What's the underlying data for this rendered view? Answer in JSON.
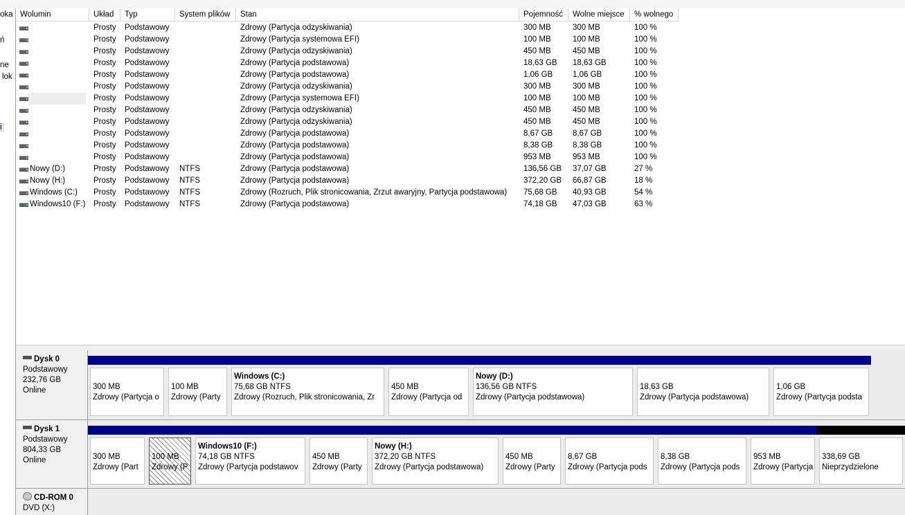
{
  "left_nav": [
    "oka",
    "ń",
    "ne",
    "lok",
    "i"
  ],
  "columns": [
    "Wolumin",
    "Układ",
    "Typ",
    "System plików",
    "Stan",
    "Pojemność",
    "Wolne miejsce",
    "% wolnego"
  ],
  "volumes": [
    {
      "name": "",
      "layout": "Prosty",
      "type": "Podstawowy",
      "fs": "",
      "status": "Zdrowy (Partycja odzyskiwania)",
      "capacity": "300 MB",
      "free": "300 MB",
      "pct": "100 %"
    },
    {
      "name": "",
      "layout": "Prosty",
      "type": "Podstawowy",
      "fs": "",
      "status": "Zdrowy (Partycja systemowa EFI)",
      "capacity": "100 MB",
      "free": "100 MB",
      "pct": "100 %"
    },
    {
      "name": "",
      "layout": "Prosty",
      "type": "Podstawowy",
      "fs": "",
      "status": "Zdrowy (Partycja odzyskiwania)",
      "capacity": "450 MB",
      "free": "450 MB",
      "pct": "100 %"
    },
    {
      "name": "",
      "layout": "Prosty",
      "type": "Podstawowy",
      "fs": "",
      "status": "Zdrowy (Partycja podstawowa)",
      "capacity": "18,63 GB",
      "free": "18,63 GB",
      "pct": "100 %"
    },
    {
      "name": "",
      "layout": "Prosty",
      "type": "Podstawowy",
      "fs": "",
      "status": "Zdrowy (Partycja podstawowa)",
      "capacity": "1,06 GB",
      "free": "1,06 GB",
      "pct": "100 %"
    },
    {
      "name": "",
      "layout": "Prosty",
      "type": "Podstawowy",
      "fs": "",
      "status": "Zdrowy (Partycja odzyskiwania)",
      "capacity": "300 MB",
      "free": "300 MB",
      "pct": "100 %"
    },
    {
      "name": "",
      "layout": "Prosty",
      "type": "Podstawowy",
      "fs": "",
      "status": "Zdrowy (Partycja systemowa EFI)",
      "capacity": "100 MB",
      "free": "100 MB",
      "pct": "100 %"
    },
    {
      "name": "",
      "layout": "Prosty",
      "type": "Podstawowy",
      "fs": "",
      "status": "Zdrowy (Partycja odzyskiwania)",
      "capacity": "450 MB",
      "free": "450 MB",
      "pct": "100 %"
    },
    {
      "name": "",
      "layout": "Prosty",
      "type": "Podstawowy",
      "fs": "",
      "status": "Zdrowy (Partycja odzyskiwania)",
      "capacity": "450 MB",
      "free": "450 MB",
      "pct": "100 %"
    },
    {
      "name": "",
      "layout": "Prosty",
      "type": "Podstawowy",
      "fs": "",
      "status": "Zdrowy (Partycja podstawowa)",
      "capacity": "8,67 GB",
      "free": "8,67 GB",
      "pct": "100 %"
    },
    {
      "name": "",
      "layout": "Prosty",
      "type": "Podstawowy",
      "fs": "",
      "status": "Zdrowy (Partycja podstawowa)",
      "capacity": "8,38 GB",
      "free": "8,38 GB",
      "pct": "100 %"
    },
    {
      "name": "",
      "layout": "Prosty",
      "type": "Podstawowy",
      "fs": "",
      "status": "Zdrowy (Partycja podstawowa)",
      "capacity": "953 MB",
      "free": "953 MB",
      "pct": "100 %"
    },
    {
      "name": "Nowy (D:)",
      "layout": "Prosty",
      "type": "Podstawowy",
      "fs": "NTFS",
      "status": "Zdrowy (Partycja podstawowa)",
      "capacity": "136,56 GB",
      "free": "37,07 GB",
      "pct": "27 %"
    },
    {
      "name": "Nowy (H:)",
      "layout": "Prosty",
      "type": "Podstawowy",
      "fs": "NTFS",
      "status": "Zdrowy (Partycja podstawowa)",
      "capacity": "372,20 GB",
      "free": "66,87 GB",
      "pct": "18 %"
    },
    {
      "name": "Windows (C:)",
      "layout": "Prosty",
      "type": "Podstawowy",
      "fs": "NTFS",
      "status": "Zdrowy (Rozruch, Plik stronicowania, Zrzut awaryjny, Partycja podstawowa)",
      "capacity": "75,68 GB",
      "free": "40,93 GB",
      "pct": "54 %"
    },
    {
      "name": "Windows10 (F:)",
      "layout": "Prosty",
      "type": "Podstawowy",
      "fs": "NTFS",
      "status": "Zdrowy (Partycja podstawowa)",
      "capacity": "74,18 GB",
      "free": "47,03 GB",
      "pct": "63 %"
    }
  ],
  "disks": [
    {
      "name": "Dysk 0",
      "kind": "Podstawowy",
      "size": "232,76 GB",
      "state": "Online",
      "partitions": [
        {
          "title": "",
          "line1": "300 MB",
          "line2": "Zdrowy (Partycja o"
        },
        {
          "title": "",
          "line1": "100 MB",
          "line2": "Zdrowy (Party"
        },
        {
          "title": "Windows  (C:)",
          "line1": "75,68 GB NTFS",
          "line2": "Zdrowy (Rozruch, Plik stronicowania, Zr"
        },
        {
          "title": "",
          "line1": "450 MB",
          "line2": "Zdrowy (Partycja od"
        },
        {
          "title": "Nowy  (D:)",
          "line1": "136,56 GB NTFS",
          "line2": "Zdrowy (Partycja podstawowa)"
        },
        {
          "title": "",
          "line1": "18,63 GB",
          "line2": "Zdrowy (Partycja podstawowa)"
        },
        {
          "title": "",
          "line1": "1,06 GB",
          "line2": "Zdrowy (Partycja podsta"
        }
      ]
    },
    {
      "name": "Dysk 1",
      "kind": "Podstawowy",
      "size": "804,33 GB",
      "state": "Online",
      "partitions": [
        {
          "title": "",
          "line1": "300 MB",
          "line2": "Zdrowy (Part"
        },
        {
          "title": "",
          "line1": "100 MB",
          "line2": "Zdrowy (P"
        },
        {
          "title": "Windows10  (F:)",
          "line1": "74,18 GB NTFS",
          "line2": "Zdrowy (Partycja podstawov"
        },
        {
          "title": "",
          "line1": "450 MB",
          "line2": "Zdrowy (Party"
        },
        {
          "title": "Nowy  (H:)",
          "line1": "372,20 GB NTFS",
          "line2": "Zdrowy (Partycja podstawowa)"
        },
        {
          "title": "",
          "line1": "450 MB",
          "line2": "Zdrowy (Party"
        },
        {
          "title": "",
          "line1": "8,67 GB",
          "line2": "Zdrowy (Partycja pods"
        },
        {
          "title": "",
          "line1": "8,38 GB",
          "line2": "Zdrowy (Partycja pods"
        },
        {
          "title": "",
          "line1": "953 MB",
          "line2": "Zdrowy (Partycja"
        },
        {
          "title": "",
          "line1": "338,69 GB",
          "line2": "Nieprzydzielone"
        }
      ]
    }
  ],
  "cdrom": {
    "name": "CD-ROM 0",
    "line1": "DVD (X:)"
  }
}
